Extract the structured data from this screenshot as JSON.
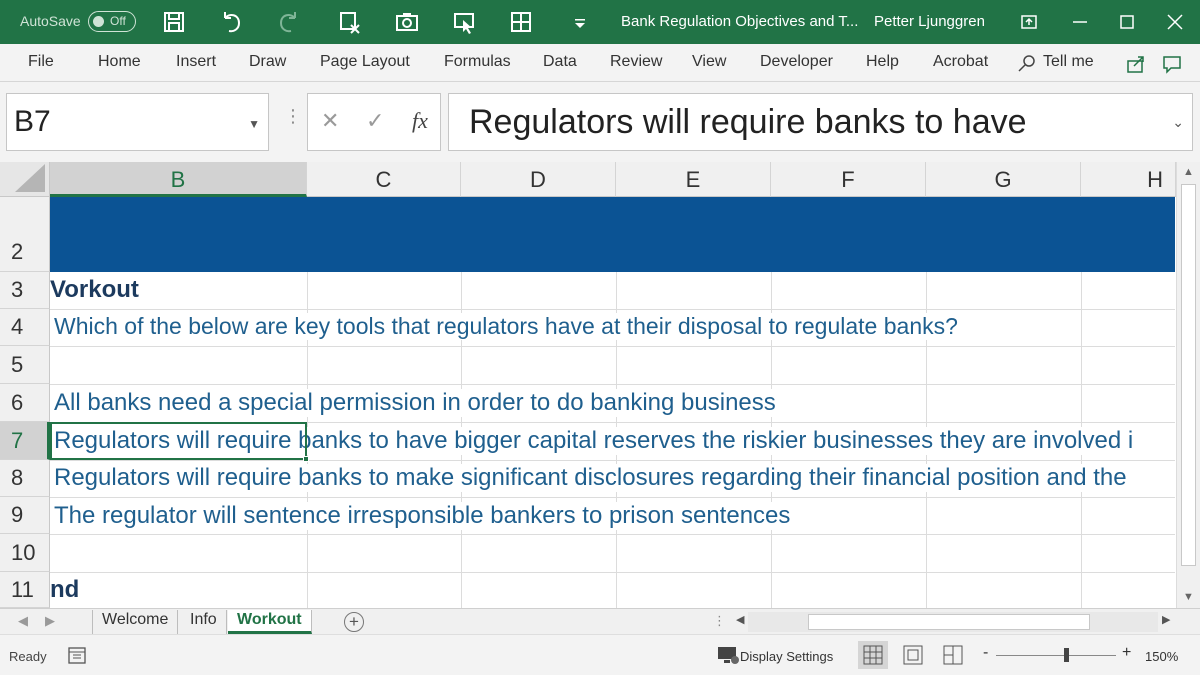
{
  "titlebar": {
    "autosave_label": "AutoSave",
    "autosave_state": "Off",
    "document_title": "Bank Regulation Objectives and T...",
    "user_name": "Petter Ljunggren",
    "accent_color": "#217346"
  },
  "ribbon": {
    "tabs": [
      "File",
      "Home",
      "Insert",
      "Draw",
      "Page Layout",
      "Formulas",
      "Data",
      "Review",
      "View",
      "Developer",
      "Help",
      "Acrobat"
    ],
    "tell_me": "Tell me"
  },
  "formula_bar": {
    "name_box": "B7",
    "fx_label": "fx",
    "content": "Regulators will require banks to have"
  },
  "grid": {
    "columns": [
      "B",
      "C",
      "D",
      "E",
      "F",
      "G",
      "H"
    ],
    "selected_column": "B",
    "rows": [
      "2",
      "3",
      "4",
      "5",
      "6",
      "7",
      "8",
      "9",
      "10",
      "11"
    ],
    "selected_row": "7",
    "banner_color": "#0b5394",
    "cells": {
      "r3": "Vorkout",
      "r4": "Which of the below are key tools that regulators have at their disposal to regulate banks?",
      "r6": "All banks need a special permission in order to do banking business",
      "r7": "Regulators will require banks to have bigger capital reserves the riskier businesses they are involved i",
      "r8": "Regulators will require banks to make significant disclosures regarding their financial position and the",
      "r9": "The regulator will sentence irresponsible bankers to prison sentences",
      "r11": "nd"
    }
  },
  "sheets": {
    "tabs": [
      "Welcome",
      "Info",
      "Workout"
    ],
    "active": "Workout"
  },
  "statusbar": {
    "ready": "Ready",
    "display_settings": "Display Settings",
    "zoom": "150%",
    "minus": "-",
    "plus": "+"
  }
}
